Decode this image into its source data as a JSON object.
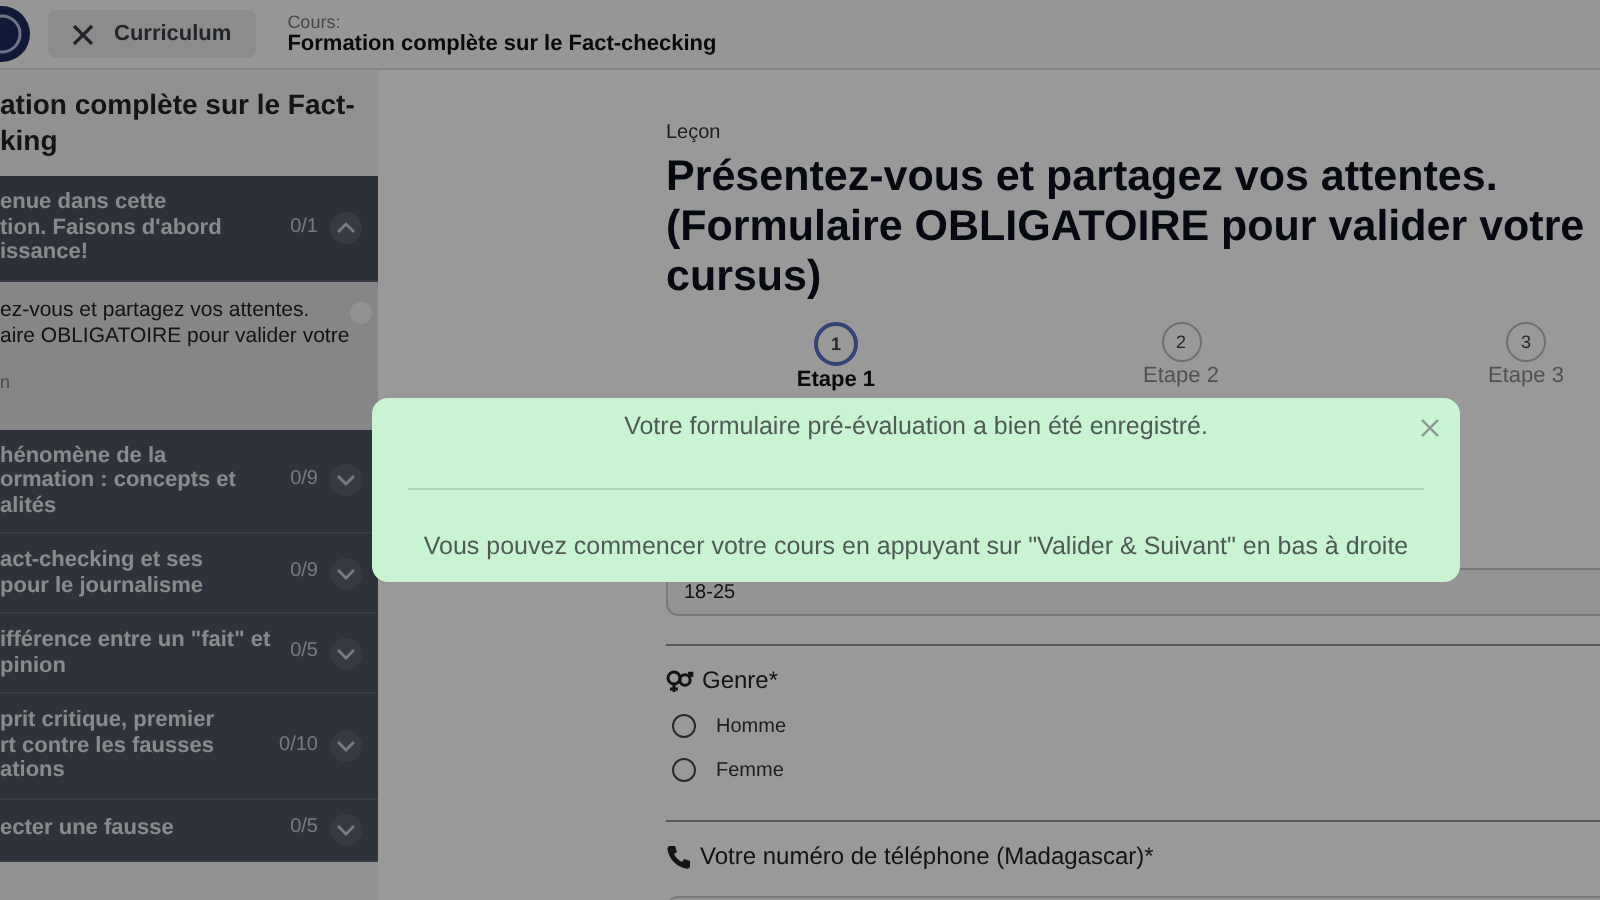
{
  "topbar": {
    "close_label": "Curriculum",
    "course_caption": "Cours:",
    "course_title": "Formation complète sur le Fact-checking"
  },
  "sidebar": {
    "title_lines": [
      "ation complète sur le Fact-",
      "king"
    ],
    "sections": [
      {
        "lines": [
          "enue dans cette",
          "tion. Faisons d'abord",
          "issance!"
        ],
        "count": "0/1",
        "expanded": true,
        "lessons": [
          {
            "lines": [
              "ez-vous et partagez vos attentes.",
              "aire OBLIGATOIRE pour valider votre"
            ],
            "type": "n",
            "done": false
          }
        ]
      },
      {
        "lines": [
          "hénomène de la",
          "ormation : concepts et",
          "alités"
        ],
        "count": "0/9",
        "expanded": false
      },
      {
        "lines": [
          "act-checking et ses",
          "pour le journalisme"
        ],
        "count": "0/9",
        "expanded": false
      },
      {
        "lines": [
          "ifférence entre un \"fait\" et",
          "pinion"
        ],
        "count": "0/5",
        "expanded": false
      },
      {
        "lines": [
          "prit critique, premier",
          "rt contre les fausses",
          "ations"
        ],
        "count": "0/10",
        "expanded": false
      },
      {
        "lines": [
          "ecter une fausse"
        ],
        "count": "0/5",
        "expanded": false
      }
    ]
  },
  "lesson": {
    "caption": "Leçon",
    "title": "Présentez-vous et partagez vos attentes. (Formulaire OBLIGATOIRE pour valider votre cursus)",
    "steps": [
      {
        "number": "1",
        "label": "Etape 1",
        "selected": true
      },
      {
        "number": "2",
        "label": "Etape 2",
        "selected": false
      },
      {
        "number": "3",
        "label": "Etape 3",
        "selected": false
      }
    ],
    "age_value": "18-25",
    "gender": {
      "label": "Genre*",
      "options": [
        {
          "label": "Homme",
          "selected": false
        },
        {
          "label": "Femme",
          "selected": false
        }
      ]
    },
    "phone": {
      "label": "Votre numéro de téléphone (Madagascar)*"
    }
  },
  "toast": {
    "message": "Votre formulaire pré-évaluation a bien été enregistré.",
    "detail": "Vous pouvez commencer votre cours en appuyant sur \"Valider & Suivant\" en bas à droite"
  }
}
